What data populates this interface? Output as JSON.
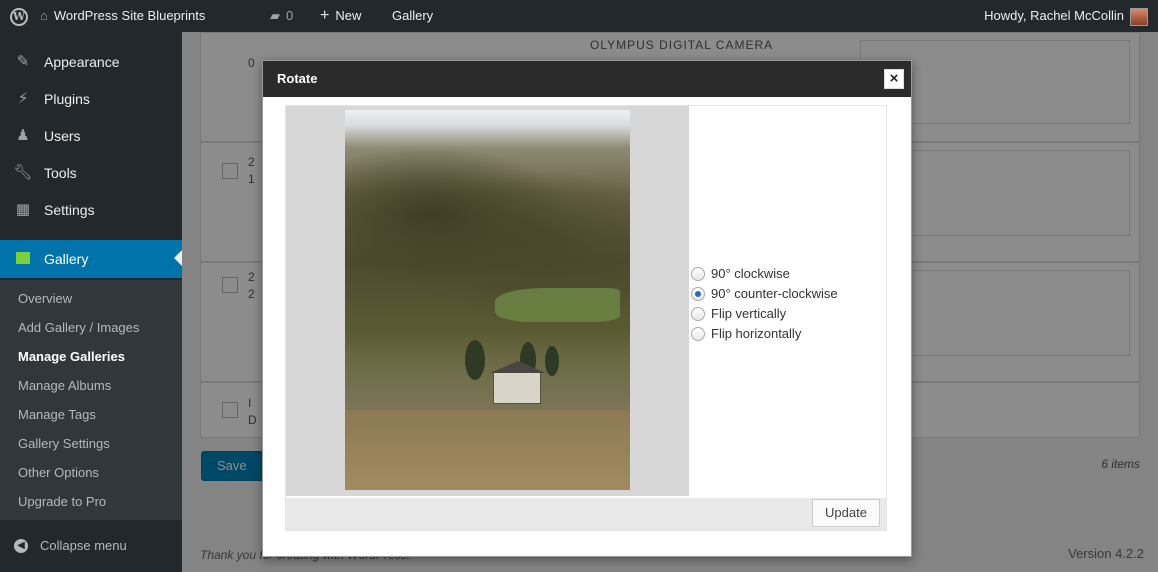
{
  "adminbar": {
    "site_name": "WordPress Site Blueprints",
    "comments_count": "0",
    "new_label": "New",
    "gallery_label": "Gallery",
    "howdy": "Howdy, Rachel McCollin"
  },
  "sidebar": {
    "items": [
      {
        "label": "Appearance",
        "icon": "paintbrush-icon"
      },
      {
        "label": "Plugins",
        "icon": "plug-icon"
      },
      {
        "label": "Users",
        "icon": "user-icon"
      },
      {
        "label": "Tools",
        "icon": "wrench-icon"
      },
      {
        "label": "Settings",
        "icon": "settings-icon"
      }
    ],
    "current": {
      "label": "Gallery",
      "icon": "gallery-icon",
      "color": "#7ad03a"
    },
    "submenu": [
      "Overview",
      "Add Gallery / Images",
      "Manage Galleries",
      "Manage Albums",
      "Manage Tags",
      "Gallery Settings",
      "Other Options",
      "Upgrade to Pro"
    ],
    "collapse_label": "Collapse menu"
  },
  "background": {
    "camera_text": "OLYMPUS DIGITAL CAMERA",
    "row_frags": [
      "2",
      "1",
      "2",
      "2",
      "I",
      "D",
      "0"
    ],
    "save_label": "Save Changes",
    "items_count": "6 items",
    "footer_left": "Thank you for creating with WordPress.",
    "version": "Version 4.2.2"
  },
  "dialog": {
    "title": "Rotate",
    "close_symbol": "×",
    "options": [
      {
        "label": "90° clockwise",
        "checked": false
      },
      {
        "label": "90° counter-clockwise",
        "checked": true
      },
      {
        "label": "Flip vertically",
        "checked": false
      },
      {
        "label": "Flip horizontally",
        "checked": false
      }
    ],
    "update_label": "Update"
  },
  "colors": {
    "admin_dark": "#23282d",
    "accent_blue": "#0073aa",
    "button_blue": "#0085ba"
  }
}
